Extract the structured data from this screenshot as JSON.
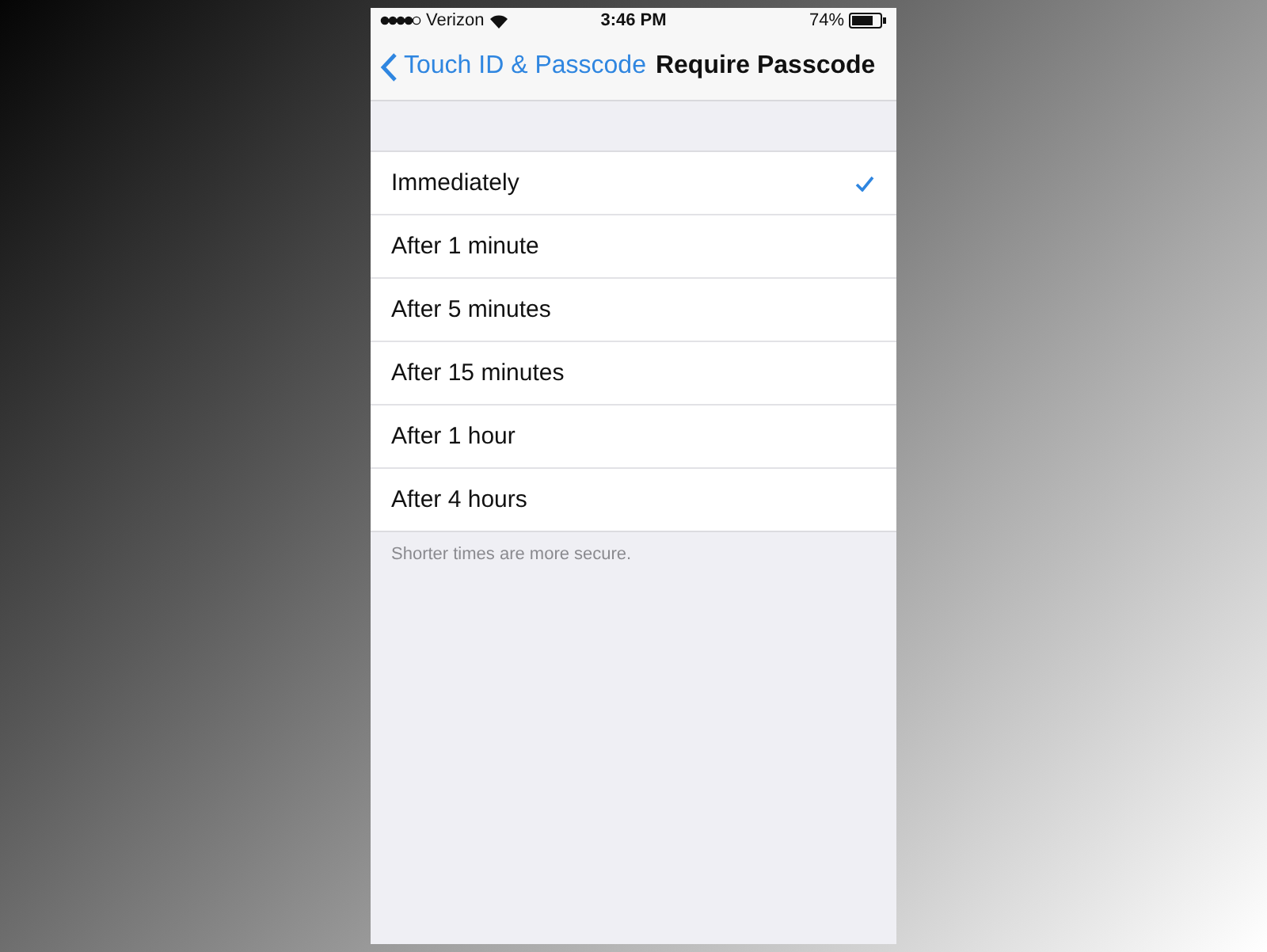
{
  "status_bar": {
    "carrier": "Verizon",
    "time": "3:46 PM",
    "battery": "74%"
  },
  "nav_bar": {
    "back": "Touch ID & Passcode",
    "title": "Require Passcode"
  },
  "options": [
    {
      "label": "Immediately",
      "selected": true
    },
    {
      "label": "After 1 minute",
      "selected": false
    },
    {
      "label": "After 5 minutes",
      "selected": false
    },
    {
      "label": "After 15 minutes",
      "selected": false
    },
    {
      "label": "After 1 hour",
      "selected": false
    },
    {
      "label": "After 4 hours",
      "selected": false
    }
  ],
  "footer": "Shorter times are more secure."
}
